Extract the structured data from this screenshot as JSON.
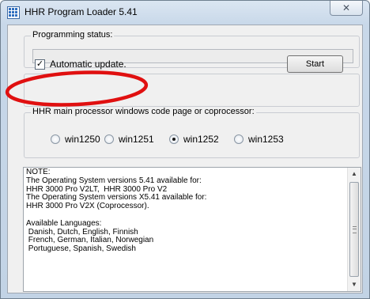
{
  "window": {
    "title": "HHR Program Loader 5.41",
    "close_glyph": "✕",
    "app_icon": "grid-app-icon"
  },
  "programming_status": {
    "label": "Programming status:",
    "value": ""
  },
  "auto_update": {
    "label": "Automatic update.",
    "checked": true,
    "check_glyph": "✓"
  },
  "start_button": {
    "label": "Start"
  },
  "code_page": {
    "label": "HHR main processor windows code page or coprocessor:",
    "options": [
      {
        "label": "win1250",
        "selected": false
      },
      {
        "label": "win1251",
        "selected": false
      },
      {
        "label": "win1252",
        "selected": true
      },
      {
        "label": "win1253",
        "selected": false
      }
    ]
  },
  "notes": {
    "text": "NOTE:\nThe Operating System versions 5.41 available for:\nHHR 3000 Pro V2LT,  HHR 3000 Pro V2\nThe Operating System versions X5.41 available for:\nHHR 3000 Pro V2X (Coprocessor).\n\nAvailable Languages:\n Danish, Dutch, English, Finnish\n French, German, Italian, Norwegian\n Portuguese, Spanish, Swedish"
  },
  "scrollbar": {
    "up_glyph": "▲",
    "down_glyph": "▼"
  },
  "colors": {
    "highlight_ellipse": "#e01010",
    "title_bar": "#c8d8e9",
    "client_background": "#f0f0f0"
  }
}
